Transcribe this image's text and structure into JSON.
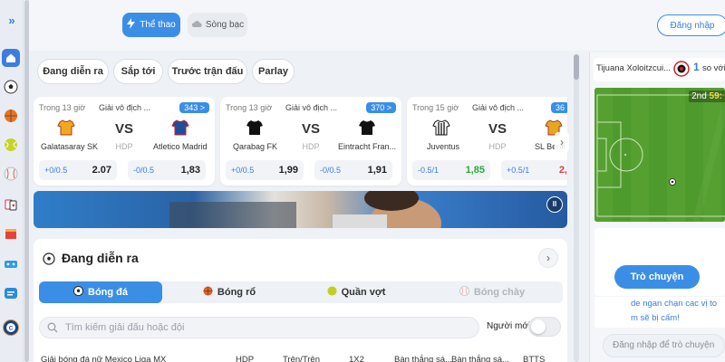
{
  "top_tabs": [
    {
      "label": "Thể thao",
      "icon": "lightning-icon",
      "active": true
    },
    {
      "label": "Sòng bạc",
      "icon": "cloud-icon",
      "active": false
    }
  ],
  "login_label": "Đăng nhập",
  "filters": [
    "Đang diễn ra",
    "Sắp tới",
    "Trước trận đấu",
    "Parlay"
  ],
  "cards": [
    {
      "time": "Trong 13 giờ",
      "league": "Giải vô địch ...",
      "count": "343 >",
      "home": "Galatasaray SK",
      "away": "Atletico Madrid",
      "vs": "VS",
      "hdp": "HDP",
      "home_line": "+0/0.5",
      "home_odd": "2.07",
      "away_line": "-0/0.5",
      "away_odd": "1,83"
    },
    {
      "time": "Trong 13 giờ",
      "league": "Giải vô địch ...",
      "count": "370 >",
      "home": "Qarabag FK",
      "away": "Eintracht Fran...",
      "vs": "VS",
      "hdp": "HDP",
      "home_line": "+0/0.5",
      "home_odd": "1,99",
      "away_line": "-0/0.5",
      "away_odd": "1,91"
    },
    {
      "time": "Trong 15 giờ",
      "league": "Giải vô địch ...",
      "count": "36",
      "home": "Juventus",
      "away": "SL Benfi",
      "vs": "VS",
      "hdp": "HDP",
      "home_line": "-0.5/1",
      "home_odd": "1,85",
      "away_line": "+0.5/1",
      "away_odd": "2,"
    }
  ],
  "live_section": {
    "title": "Đang diễn ra",
    "sports": [
      {
        "label": "Bóng đá",
        "icon": "soccer-ball-icon",
        "active": true
      },
      {
        "label": "Bóng rổ",
        "icon": "basketball-icon",
        "active": false
      },
      {
        "label": "Quần vợt",
        "icon": "tennis-ball-icon",
        "active": false
      },
      {
        "label": "Bóng chày",
        "icon": "baseball-icon",
        "active": false,
        "disabled": true
      }
    ],
    "search_placeholder": "Tìm kiếm giải đấu hoặc đội",
    "newbie_label": "Người mới",
    "newbie_on": false,
    "columns": [
      "Giải bóng đá nữ Mexico Liga MX",
      "HDP",
      "Trên/Trên",
      "1X2",
      "Bàn thắng sá...",
      "Bàn thắng sá...",
      "BTTS"
    ]
  },
  "right_panel": {
    "home_team": "Tijuana Xoloitzcui...",
    "score": "1",
    "away_team": "so với",
    "period_label": "2nd",
    "period_time": "59:",
    "chat_button": "Trò chuyện",
    "chat_lines": [
      "de ngan chạn cac vị to",
      "m sẽ bị cấm!"
    ],
    "chat_placeholder": "Đăng nhập để trò chuyện"
  },
  "colors": {
    "accent": "#3b8ee6",
    "odd_green": "#2fa83a",
    "odd_red": "#e23b3b"
  }
}
